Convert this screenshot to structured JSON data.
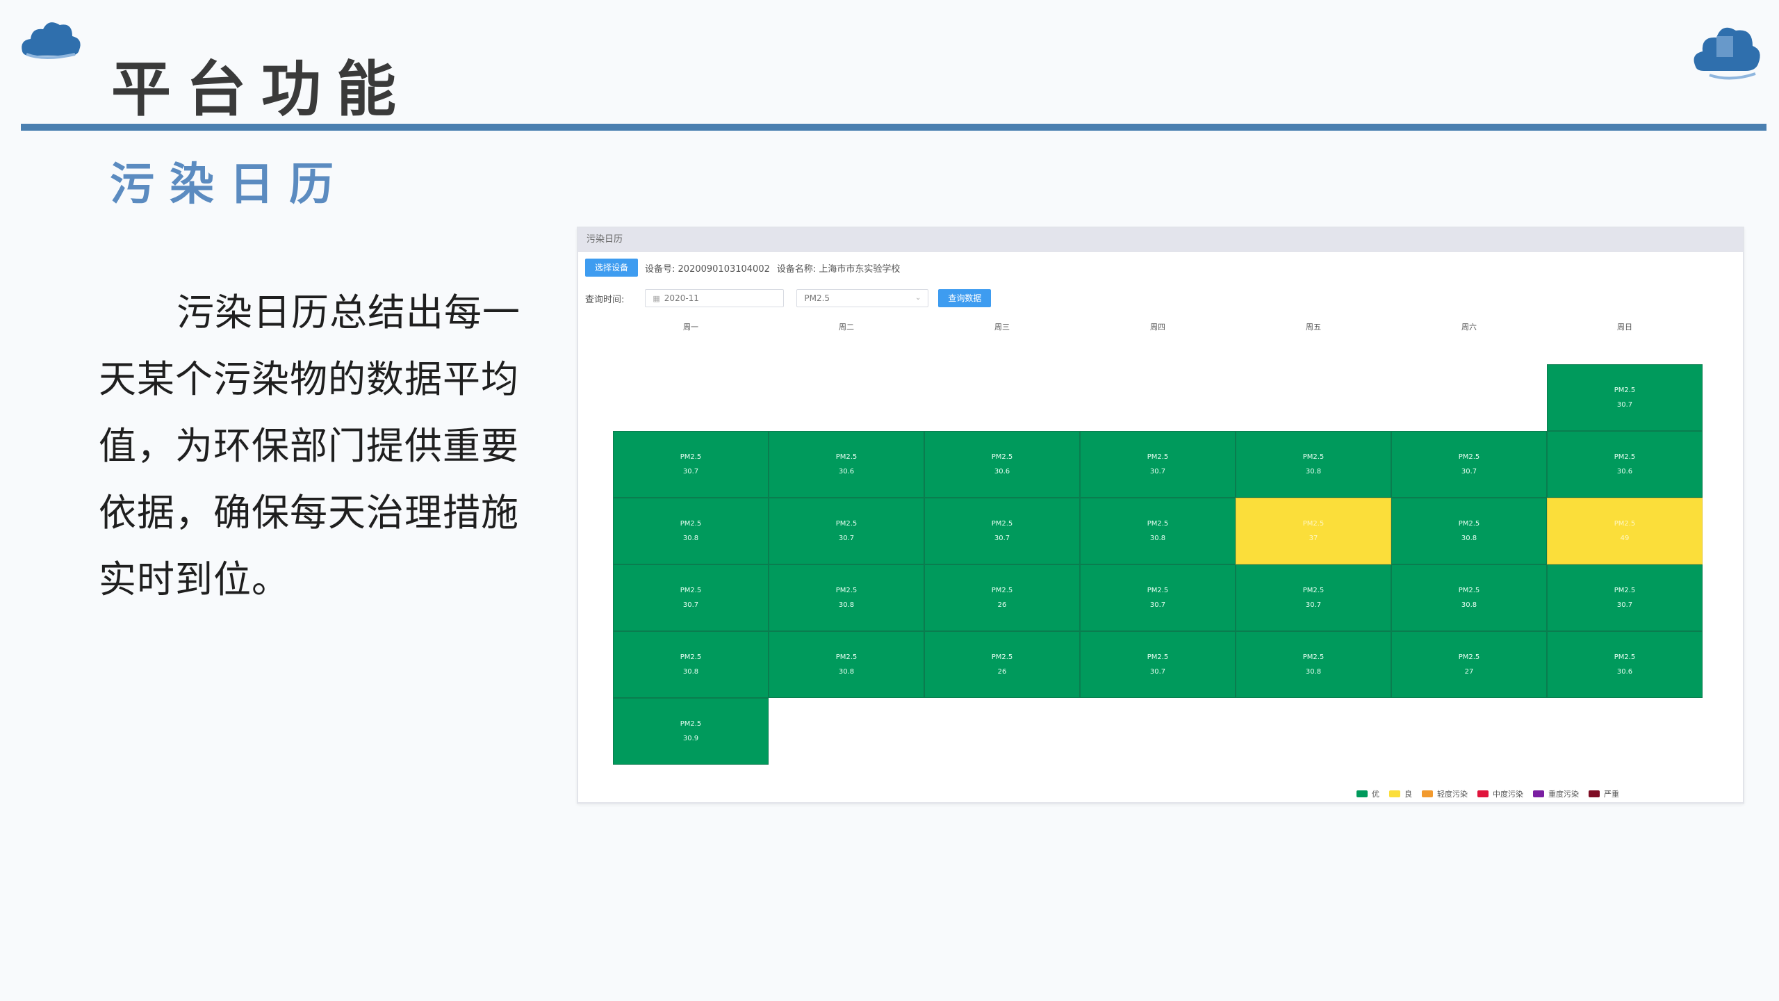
{
  "slide": {
    "title": "平台功能",
    "section": "污染日历",
    "description": "污染日历总结出每一天某个污染物的数据平均值，为环保部门提供重要依据，确保每天治理措施实时到位。"
  },
  "app": {
    "header_title": "污染日历",
    "select_device_label": "选择设备",
    "device_no_label": "设备号: 2020090103104002",
    "device_name_label": "设备名称: 上海市市东实验学校",
    "query_time_label": "查询时间:",
    "date_value": "2020-11",
    "pollutant_value": "PM2.5",
    "query_button_label": "查询数据",
    "weekdays": [
      "周一",
      "周二",
      "周三",
      "周四",
      "周五",
      "周六",
      "周日"
    ],
    "legend": [
      {
        "label": "优",
        "color": "#009a5c"
      },
      {
        "label": "良",
        "color": "#fbde3a"
      },
      {
        "label": "轻度污染",
        "color": "#f29a2e"
      },
      {
        "label": "中度污染",
        "color": "#e0143c"
      },
      {
        "label": "重度污染",
        "color": "#7a1fa2"
      },
      {
        "label": "严重",
        "color": "#7e0d24"
      }
    ],
    "calendar": [
      {
        "week": 0,
        "day": 6,
        "pollutant": "PM2.5",
        "value": "30.7",
        "level": "good"
      },
      {
        "week": 1,
        "day": 0,
        "pollutant": "PM2.5",
        "value": "30.7",
        "level": "good"
      },
      {
        "week": 1,
        "day": 1,
        "pollutant": "PM2.5",
        "value": "30.6",
        "level": "good"
      },
      {
        "week": 1,
        "day": 2,
        "pollutant": "PM2.5",
        "value": "30.6",
        "level": "good"
      },
      {
        "week": 1,
        "day": 3,
        "pollutant": "PM2.5",
        "value": "30.7",
        "level": "good"
      },
      {
        "week": 1,
        "day": 4,
        "pollutant": "PM2.5",
        "value": "30.8",
        "level": "good"
      },
      {
        "week": 1,
        "day": 5,
        "pollutant": "PM2.5",
        "value": "30.7",
        "level": "good"
      },
      {
        "week": 1,
        "day": 6,
        "pollutant": "PM2.5",
        "value": "30.6",
        "level": "good"
      },
      {
        "week": 2,
        "day": 0,
        "pollutant": "PM2.5",
        "value": "30.8",
        "level": "good"
      },
      {
        "week": 2,
        "day": 1,
        "pollutant": "PM2.5",
        "value": "30.7",
        "level": "good"
      },
      {
        "week": 2,
        "day": 2,
        "pollutant": "PM2.5",
        "value": "30.7",
        "level": "good"
      },
      {
        "week": 2,
        "day": 3,
        "pollutant": "PM2.5",
        "value": "30.8",
        "level": "good"
      },
      {
        "week": 2,
        "day": 4,
        "pollutant": "PM2.5",
        "value": "37",
        "level": "fair"
      },
      {
        "week": 2,
        "day": 5,
        "pollutant": "PM2.5",
        "value": "30.8",
        "level": "good"
      },
      {
        "week": 2,
        "day": 6,
        "pollutant": "PM2.5",
        "value": "49",
        "level": "fair"
      },
      {
        "week": 3,
        "day": 0,
        "pollutant": "PM2.5",
        "value": "30.7",
        "level": "good"
      },
      {
        "week": 3,
        "day": 1,
        "pollutant": "PM2.5",
        "value": "30.8",
        "level": "good"
      },
      {
        "week": 3,
        "day": 2,
        "pollutant": "PM2.5",
        "value": "26",
        "level": "good"
      },
      {
        "week": 3,
        "day": 3,
        "pollutant": "PM2.5",
        "value": "30.7",
        "level": "good"
      },
      {
        "week": 3,
        "day": 4,
        "pollutant": "PM2.5",
        "value": "30.7",
        "level": "good"
      },
      {
        "week": 3,
        "day": 5,
        "pollutant": "PM2.5",
        "value": "30.8",
        "level": "good"
      },
      {
        "week": 3,
        "day": 6,
        "pollutant": "PM2.5",
        "value": "30.7",
        "level": "good"
      },
      {
        "week": 4,
        "day": 0,
        "pollutant": "PM2.5",
        "value": "30.8",
        "level": "good"
      },
      {
        "week": 4,
        "day": 1,
        "pollutant": "PM2.5",
        "value": "30.8",
        "level": "good"
      },
      {
        "week": 4,
        "day": 2,
        "pollutant": "PM2.5",
        "value": "26",
        "level": "good"
      },
      {
        "week": 4,
        "day": 3,
        "pollutant": "PM2.5",
        "value": "30.7",
        "level": "good"
      },
      {
        "week": 4,
        "day": 4,
        "pollutant": "PM2.5",
        "value": "30.8",
        "level": "good"
      },
      {
        "week": 4,
        "day": 5,
        "pollutant": "PM2.5",
        "value": "27",
        "level": "good"
      },
      {
        "week": 4,
        "day": 6,
        "pollutant": "PM2.5",
        "value": "30.6",
        "level": "good"
      },
      {
        "week": 5,
        "day": 0,
        "pollutant": "PM2.5",
        "value": "30.9",
        "level": "good"
      }
    ]
  }
}
